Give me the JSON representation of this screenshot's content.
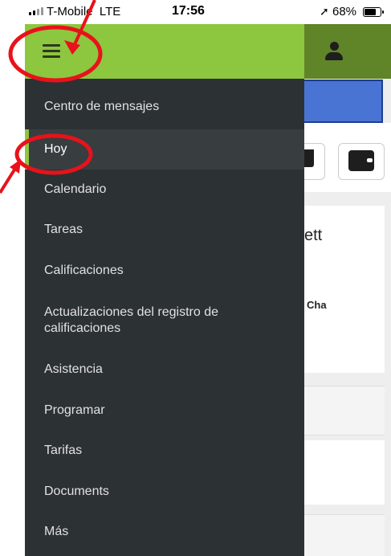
{
  "status_bar": {
    "carrier": "T-Mobile",
    "network": "LTE",
    "time": "17:56",
    "battery": "68%",
    "battery_level": 0.68
  },
  "menu": {
    "items": [
      {
        "label": "Centro de mensajes"
      },
      {
        "label": "Hoy"
      },
      {
        "label": "Calendario"
      },
      {
        "label": "Tareas"
      },
      {
        "label": "Calificaciones"
      },
      {
        "label": "Actualizaciones del registro de calificaciones"
      },
      {
        "label": "Asistencia"
      },
      {
        "label": "Programar"
      },
      {
        "label": "Tarifas"
      },
      {
        "label": "Documents"
      },
      {
        "label": "Más"
      }
    ],
    "active": "Hoy"
  },
  "background": {
    "text_1": "ett",
    "text_2": "Cha"
  },
  "colors": {
    "drawer_header": "#8dc63f",
    "drawer_bg": "#2c3134",
    "app_header": "#5f8528",
    "annotation": "#e8121a",
    "highlight_box": "#4a74d4"
  },
  "icons": [
    "menu-icon",
    "user-icon",
    "cart-icon",
    "wallet-icon",
    "location-arrow-icon",
    "battery-icon",
    "signal-icon"
  ]
}
